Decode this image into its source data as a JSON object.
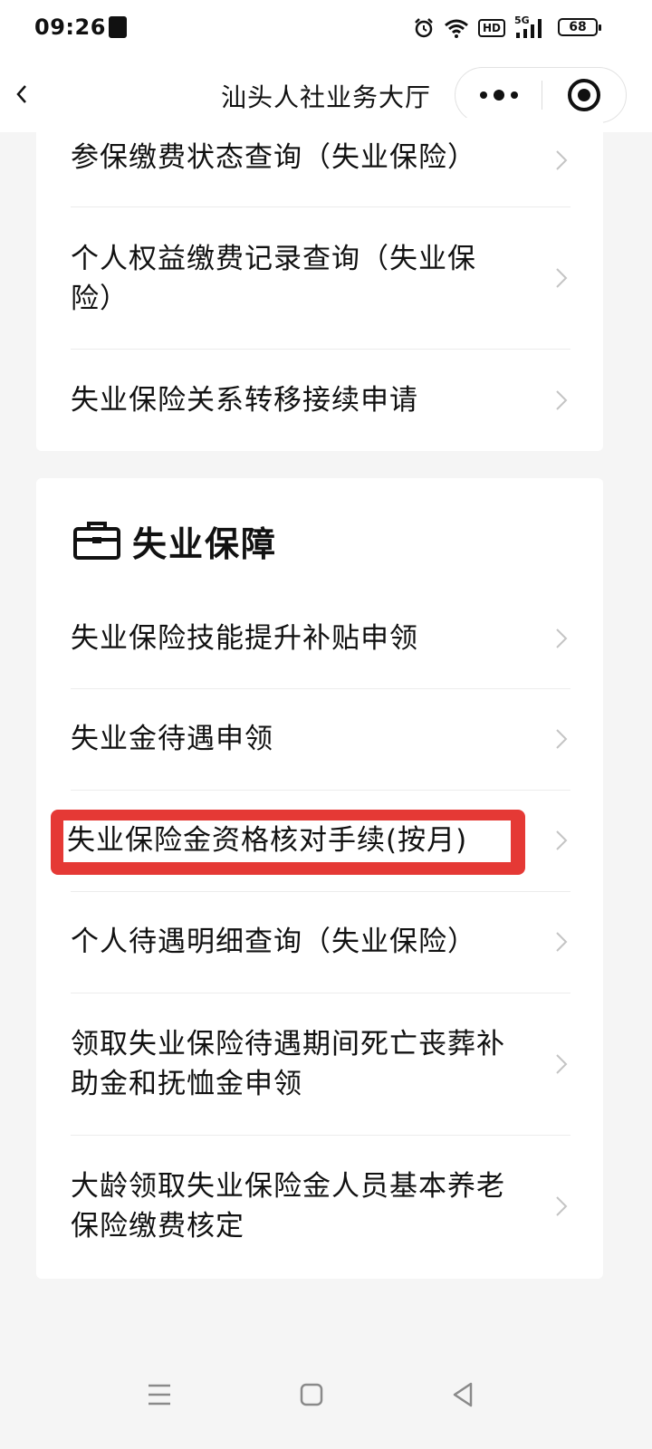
{
  "status_bar": {
    "time": "09:26",
    "network": "5G",
    "hd_badge": "HD",
    "battery": "68"
  },
  "nav": {
    "title": "汕头人社业务大厅"
  },
  "card_top": {
    "items": [
      "参保缴费状态查询（失业保险）",
      "个人权益缴费记录查询（失业保险）",
      "失业保险关系转移接续申请"
    ]
  },
  "section": {
    "title": "失业保障",
    "icon": "briefcase-icon",
    "items": [
      "失业保险技能提升补贴申领",
      "失业金待遇申领",
      "失业保险金资格核对手续(按月)",
      "个人待遇明细查询（失业保险）",
      "领取失业保险待遇期间死亡丧葬补助金和抚恤金申领",
      "大龄领取失业保险金人员基本养老保险缴费核定"
    ]
  },
  "highlight_color": "#e53935"
}
